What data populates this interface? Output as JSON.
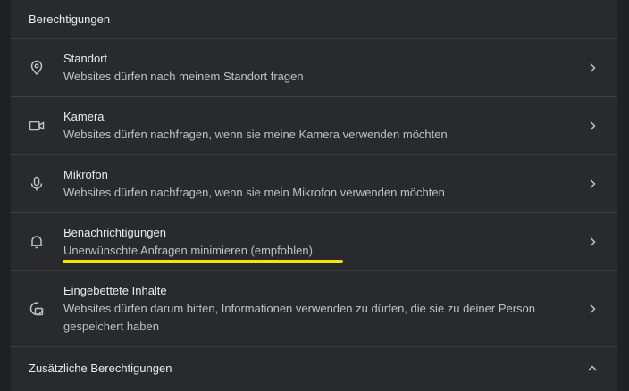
{
  "section_title": "Berechtigungen",
  "permissions": [
    {
      "title": "Standort",
      "description": "Websites dürfen nach meinem Standort fragen",
      "icon": "location-pin-icon"
    },
    {
      "title": "Kamera",
      "description": "Websites dürfen nachfragen, wenn sie meine Kamera verwenden möchten",
      "icon": "camera-icon"
    },
    {
      "title": "Mikrofon",
      "description": "Websites dürfen nachfragen, wenn sie mein Mikrofon verwenden möchten",
      "icon": "microphone-icon"
    },
    {
      "title": "Benachrichtigungen",
      "description": "Unerwünschte Anfragen minimieren (empfohlen)",
      "icon": "bell-icon"
    },
    {
      "title": "Eingebettete Inhalte",
      "description": "Websites dürfen darum bitten, Informationen verwenden zu dürfen, die sie zu deiner Person gespeichert haben",
      "icon": "embedded-content-icon"
    }
  ],
  "additional_permissions_label": "Zusätzliche Berechtigungen",
  "colors": {
    "background": "#202124",
    "panel": "#292a2d",
    "divider": "#3c4043",
    "highlight": "#f5e600",
    "text_primary": "#e8eaed",
    "text_secondary": "#bdc1c6"
  }
}
